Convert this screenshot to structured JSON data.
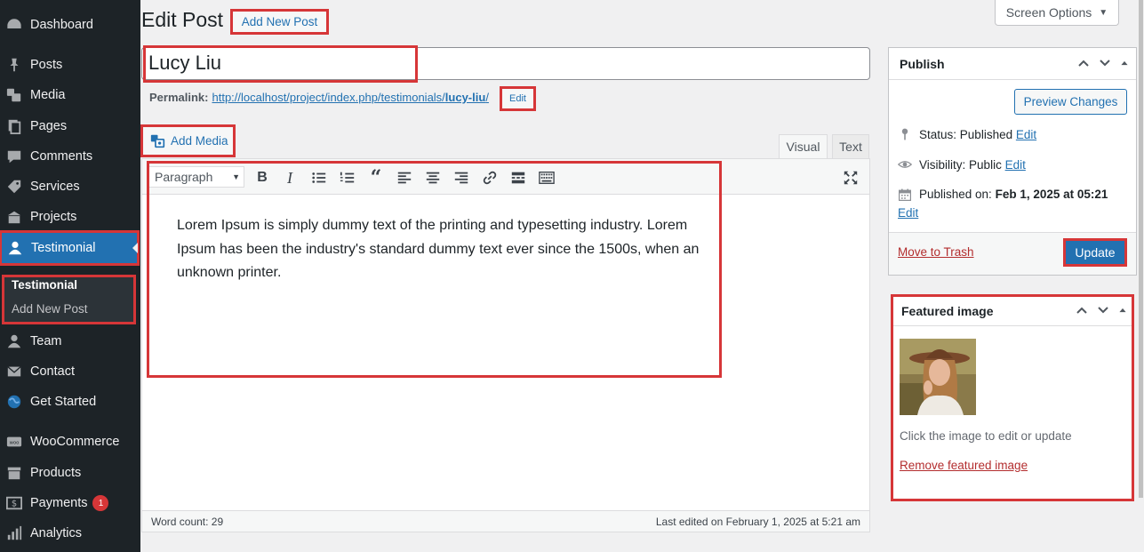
{
  "sidebar": {
    "items": [
      {
        "label": "Dashboard",
        "icon": "dashboard-icon"
      },
      {
        "label": "Posts",
        "icon": "pin-icon"
      },
      {
        "label": "Media",
        "icon": "media-icon"
      },
      {
        "label": "Pages",
        "icon": "pages-icon"
      },
      {
        "label": "Comments",
        "icon": "comments-icon"
      },
      {
        "label": "Services",
        "icon": "tag-icon"
      },
      {
        "label": "Projects",
        "icon": "portfolio-icon"
      },
      {
        "label": "Testimonial",
        "icon": "user-icon"
      },
      {
        "label": "Team",
        "icon": "user-icon"
      },
      {
        "label": "Contact",
        "icon": "mail-icon"
      },
      {
        "label": "Get Started",
        "icon": "globe-icon"
      },
      {
        "label": "WooCommerce",
        "icon": "woo-icon"
      },
      {
        "label": "Products",
        "icon": "archive-icon"
      },
      {
        "label": "Payments",
        "icon": "dollar-icon",
        "badge": "1"
      },
      {
        "label": "Analytics",
        "icon": "bar-chart-icon"
      }
    ],
    "submenu": {
      "heading": "Testimonial",
      "link": "Add New Post"
    }
  },
  "header": {
    "title": "Edit Post",
    "add_new_label": "Add New Post",
    "screen_options_label": "Screen Options"
  },
  "post": {
    "title": "Lucy Liu",
    "permalink_label": "Permalink:",
    "permalink_base": "http://localhost/project/index.php/testimonials/",
    "permalink_slug": "lucy-liu",
    "permalink_trail": "/",
    "permalink_edit": "Edit"
  },
  "editor": {
    "add_media_label": "Add Media",
    "tab_visual": "Visual",
    "tab_text": "Text",
    "format_value": "Paragraph",
    "content": "Lorem Ipsum is simply dummy text of the printing and typesetting industry. Lorem Ipsum has been the industry's standard dummy text ever since the 1500s, when an unknown printer.",
    "word_count": "Word count: 29",
    "last_edited": "Last edited on February 1, 2025 at 5:21 am"
  },
  "publish": {
    "title": "Publish",
    "preview_label": "Preview Changes",
    "status_label": "Status:",
    "status_value": "Published",
    "visibility_label": "Visibility:",
    "visibility_value": "Public",
    "published_label": "Published on:",
    "published_value": "Feb 1, 2025 at 05:21",
    "edit_label": "Edit",
    "trash_label": "Move to Trash",
    "update_label": "Update"
  },
  "featured": {
    "title": "Featured image",
    "help": "Click the image to edit or update",
    "remove_label": "Remove featured image"
  },
  "colors": {
    "accent": "#2271b1",
    "highlight": "#d63638",
    "sidebar_bg": "#1d2327"
  }
}
